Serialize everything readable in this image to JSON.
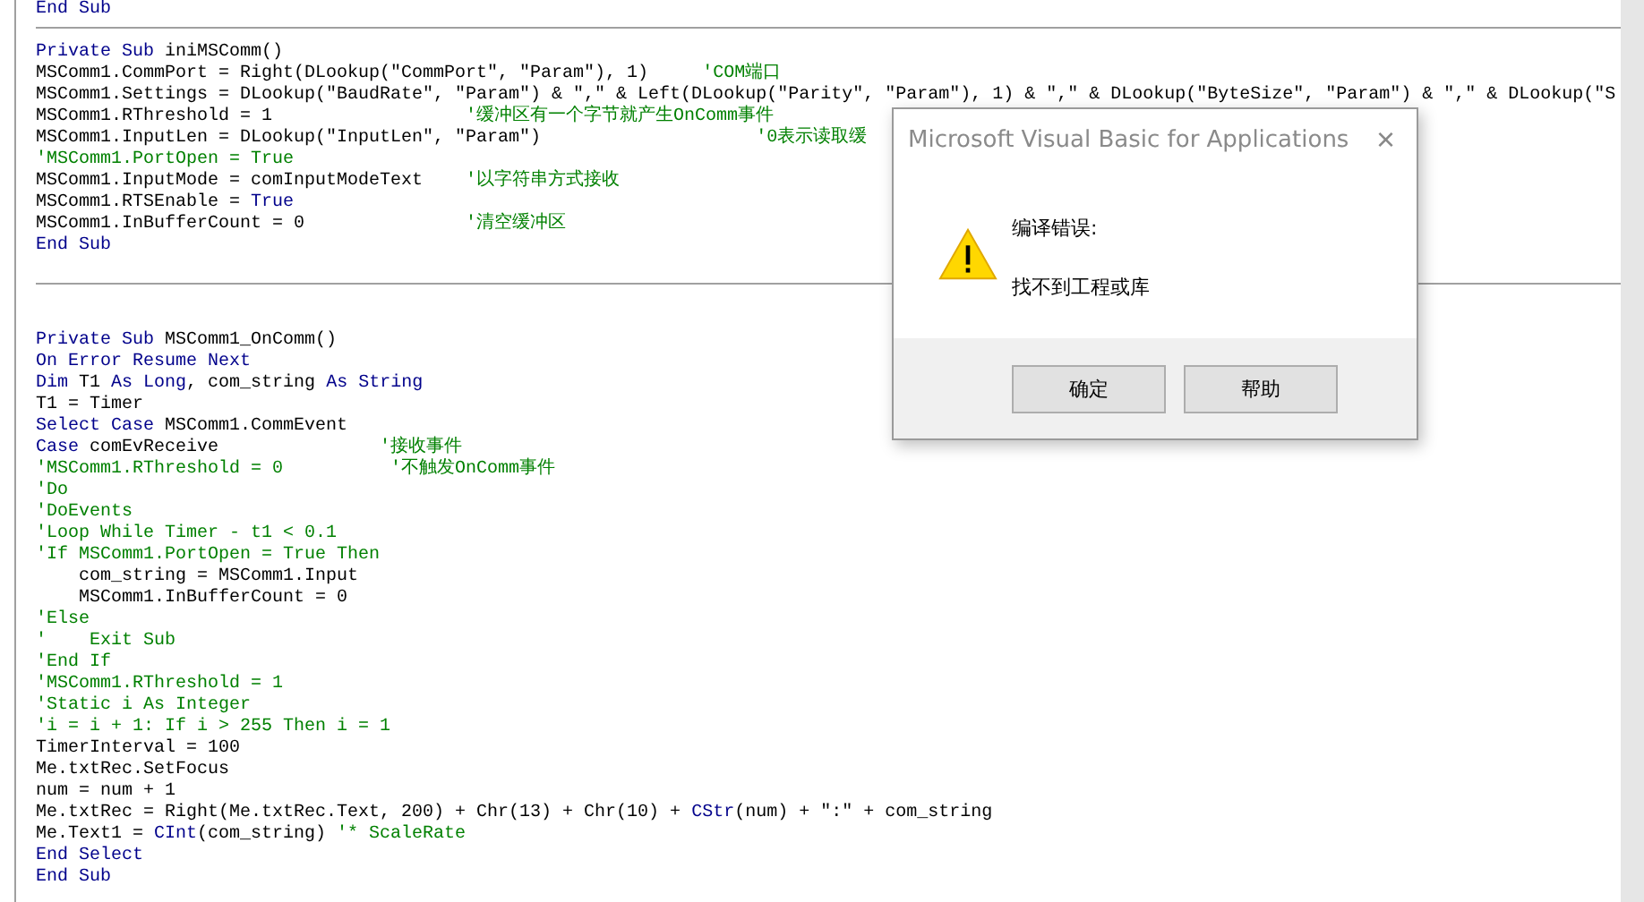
{
  "editor": {
    "procedures": [
      {
        "lines": [
          [
            {
              "kind": "keyword",
              "text": "End Sub"
            }
          ]
        ]
      },
      {
        "lines": [
          [
            {
              "kind": "keyword",
              "text": "Private Sub "
            },
            {
              "kind": "plain",
              "text": "iniMSComm()"
            }
          ],
          [
            {
              "kind": "plain",
              "text": "MSComm1.CommPort = Right(DLookup(\"CommPort\", \"Param\"), 1)     "
            },
            {
              "kind": "comment",
              "text": "'COM端口"
            }
          ],
          [
            {
              "kind": "plain",
              "text": "MSComm1.Settings = DLookup(\"BaudRate\", \"Param\") & \",\" & Left(DLookup(\"Parity\", \"Param\"), 1) & \",\" & DLookup(\"ByteSize\", \"Param\") & \",\" & DLookup(\"S"
            }
          ],
          [
            {
              "kind": "plain",
              "text": "MSComm1.RThreshold = 1                  "
            },
            {
              "kind": "comment",
              "text": "'缓冲区有一个字节就产生OnComm事件"
            }
          ],
          [
            {
              "kind": "plain",
              "text": "MSComm1.InputLen = DLookup(\"InputLen\", \"Param\")                    "
            },
            {
              "kind": "comment",
              "text": "'0表示读取缓"
            }
          ],
          [
            {
              "kind": "comment",
              "text": "'MSComm1.PortOpen = True"
            }
          ],
          [
            {
              "kind": "plain",
              "text": "MSComm1.InputMode = comInputModeText    "
            },
            {
              "kind": "comment",
              "text": "'以字符串方式接收"
            }
          ],
          [
            {
              "kind": "plain",
              "text": "MSComm1.RTSEnable = "
            },
            {
              "kind": "keyword",
              "text": "True"
            }
          ],
          [
            {
              "kind": "plain",
              "text": "MSComm1.InBufferCount = 0               "
            },
            {
              "kind": "comment",
              "text": "'清空缓冲区"
            }
          ],
          [
            {
              "kind": "keyword",
              "text": "End Sub"
            }
          ]
        ]
      },
      {
        "lines": [
          [
            {
              "kind": "keyword",
              "text": "Private Sub "
            },
            {
              "kind": "plain",
              "text": "MSComm1_OnComm()"
            }
          ],
          [
            {
              "kind": "keyword",
              "text": "On Error Resume Next"
            }
          ],
          [
            {
              "kind": "keyword",
              "text": "Dim "
            },
            {
              "kind": "plain",
              "text": "T1 "
            },
            {
              "kind": "keyword",
              "text": "As Long"
            },
            {
              "kind": "plain",
              "text": ", com_string "
            },
            {
              "kind": "keyword",
              "text": "As String"
            }
          ],
          [
            {
              "kind": "plain",
              "text": "T1 = Timer"
            }
          ],
          [
            {
              "kind": "keyword",
              "text": "Select Case "
            },
            {
              "kind": "plain",
              "text": "MSComm1.CommEvent"
            }
          ],
          [
            {
              "kind": "keyword",
              "text": "Case "
            },
            {
              "kind": "plain",
              "text": "comEvReceive               "
            },
            {
              "kind": "comment",
              "text": "'接收事件"
            }
          ],
          [
            {
              "kind": "comment",
              "text": "'MSComm1.RThreshold = 0          '不触发OnComm事件"
            }
          ],
          [
            {
              "kind": "comment",
              "text": "'Do"
            }
          ],
          [
            {
              "kind": "comment",
              "text": "'DoEvents"
            }
          ],
          [
            {
              "kind": "comment",
              "text": "'Loop While Timer - t1 < 0.1"
            }
          ],
          [
            {
              "kind": "comment",
              "text": "'If MSComm1.PortOpen = True Then"
            }
          ],
          [
            {
              "kind": "plain",
              "text": "    com_string = MSComm1.Input"
            }
          ],
          [
            {
              "kind": "plain",
              "text": "    MSComm1.InBufferCount = 0"
            }
          ],
          [
            {
              "kind": "comment",
              "text": "'Else"
            }
          ],
          [
            {
              "kind": "comment",
              "text": "'    Exit Sub"
            }
          ],
          [
            {
              "kind": "comment",
              "text": "'End If"
            }
          ],
          [
            {
              "kind": "comment",
              "text": "'MSComm1.RThreshold = 1"
            }
          ],
          [
            {
              "kind": "comment",
              "text": "'Static i As Integer"
            }
          ],
          [
            {
              "kind": "comment",
              "text": "'i = i + 1: If i > 255 Then i = 1"
            }
          ],
          [
            {
              "kind": "plain",
              "text": "TimerInterval = 100"
            }
          ],
          [
            {
              "kind": "plain",
              "text": "Me.txtRec.SetFocus"
            }
          ],
          [
            {
              "kind": "plain",
              "text": "num = num + 1"
            }
          ],
          [
            {
              "kind": "plain",
              "text": "Me.txtRec = Right(Me.txtRec.Text, 200) + Chr(13) + Chr(10) + "
            },
            {
              "kind": "keyword",
              "text": "CStr"
            },
            {
              "kind": "plain",
              "text": "(num) + \":\" + com_string"
            }
          ],
          [
            {
              "kind": "plain",
              "text": "Me.Text1 = "
            },
            {
              "kind": "keyword",
              "text": "CInt"
            },
            {
              "kind": "plain",
              "text": "(com_string) "
            },
            {
              "kind": "comment",
              "text": "'* ScaleRate"
            }
          ],
          [
            {
              "kind": "keyword",
              "text": "End Select"
            }
          ],
          [
            {
              "kind": "keyword",
              "text": "End Sub"
            }
          ]
        ]
      }
    ]
  },
  "dialog": {
    "title": "Microsoft Visual Basic for Applications",
    "close": "×",
    "heading": "编译错误:",
    "message": "找不到工程或库",
    "buttons": [
      "确定",
      "帮助"
    ]
  }
}
